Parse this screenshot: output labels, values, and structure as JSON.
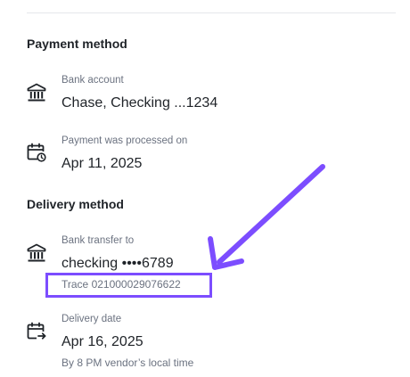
{
  "payment_method": {
    "title": "Payment method",
    "bank_account": {
      "label": "Bank account",
      "value": "Chase, Checking ...1234",
      "icon": "bank-icon"
    },
    "processed": {
      "label": "Payment was processed on",
      "value": "Apr 11, 2025",
      "icon": "calendar-clock-icon"
    }
  },
  "delivery_method": {
    "title": "Delivery method",
    "bank_transfer": {
      "label": "Bank transfer to",
      "value": "checking ••••6789",
      "trace": "Trace 021000029076622",
      "icon": "bank-icon"
    },
    "delivery_date": {
      "label": "Delivery date",
      "value": "Apr 16, 2025",
      "note": "By 8 PM vendor’s local time",
      "icon": "calendar-arrow-icon"
    }
  },
  "annotation": {
    "color": "#7c4dff"
  }
}
